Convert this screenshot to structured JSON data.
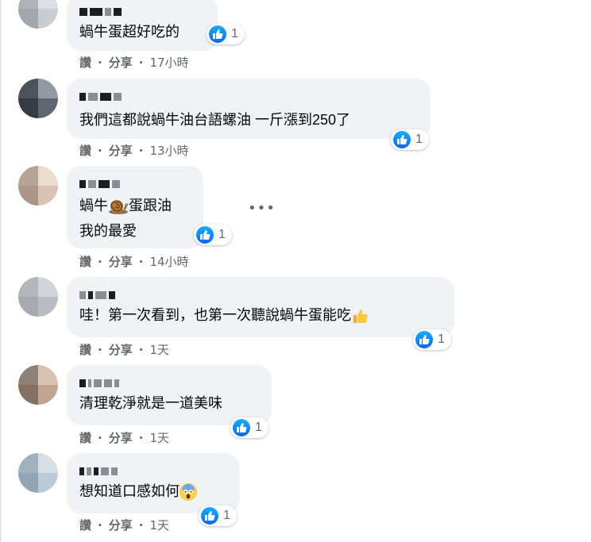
{
  "comments": [
    {
      "text": "蝸牛蛋超好吃的",
      "reactions": "1",
      "like": "讚",
      "share": "分享",
      "time": "17小時"
    },
    {
      "text": "我們這都說蝸牛油台語螺油 一斤漲到250了",
      "reactions": "1",
      "like": "讚",
      "share": "分享",
      "time": "13小時"
    },
    {
      "text_part1": "蝸牛",
      "text_part2": "蛋跟油",
      "text_line2": "我的最愛",
      "reactions": "1",
      "like": "讚",
      "share": "分享",
      "time": "14小時",
      "more": "•••"
    },
    {
      "text": "哇！第一次看到，也第一次聽說蝸牛蛋能吃",
      "reactions": "1",
      "like": "讚",
      "share": "分享",
      "time": "1天"
    },
    {
      "text": "清理乾淨就是一道美味",
      "reactions": "1",
      "like": "讚",
      "share": "分享",
      "time": "1天"
    },
    {
      "text": "想知道口感如何",
      "reactions": "1",
      "like": "讚",
      "share": "分享",
      "time": "1天"
    }
  ],
  "separator": "·",
  "icons": {
    "reaction": "like-icon",
    "emoji_snail": "snail-emoji",
    "emoji_thumb": "thumbs-up-emoji",
    "emoji_scream": "scream-emoji",
    "more": "more-options-icon"
  },
  "colors": {
    "bubble": "#f0f2f5",
    "meta": "#65676b",
    "like_blue": "#1877f2"
  }
}
